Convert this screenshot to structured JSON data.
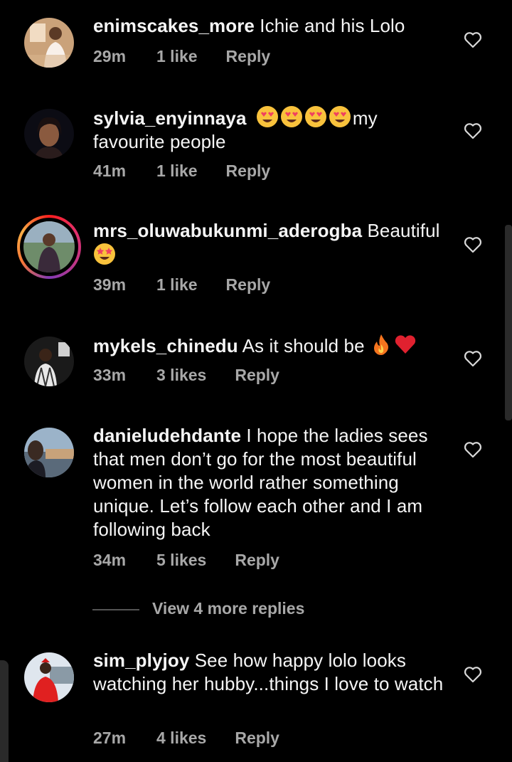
{
  "comments": [
    {
      "username": "enimscakes_more",
      "text": " Ichie and his Lolo",
      "time": "29m",
      "likes": "1 like",
      "reply": "Reply"
    },
    {
      "username": "sylvia_enyinnaya",
      "text_after_emoji": "my favourite people",
      "emoji": "heart-eyes x4",
      "time": "41m",
      "likes": "1 like",
      "reply": "Reply"
    },
    {
      "username": "mrs_oluwabukunmi_aderogba",
      "text": " Beautiful",
      "emoji": "star-struck",
      "time": "39m",
      "likes": "1 like",
      "reply": "Reply"
    },
    {
      "username": "mykels_chinedu",
      "text": " As it should be ",
      "emoji": "fire, red-heart",
      "time": "33m",
      "likes": "3 likes",
      "reply": "Reply"
    },
    {
      "username": "danieludehdante",
      "text": " I hope the ladies sees that men don’t go for the most beautiful women in the world rather something unique.  Let’s follow each other and I am following back",
      "time": "34m",
      "likes": "5 likes",
      "reply": "Reply"
    },
    {
      "username": "sim_plyjoy",
      "text": " See how happy lolo looks watching her hubby...things I love to watch",
      "time": "27m",
      "likes": "4 likes",
      "reply": "Reply"
    }
  ],
  "view_more_replies": "View 4 more replies",
  "colors": {
    "background": "#000000",
    "text": "#f5f5f5",
    "meta": "#a8a8a8"
  }
}
